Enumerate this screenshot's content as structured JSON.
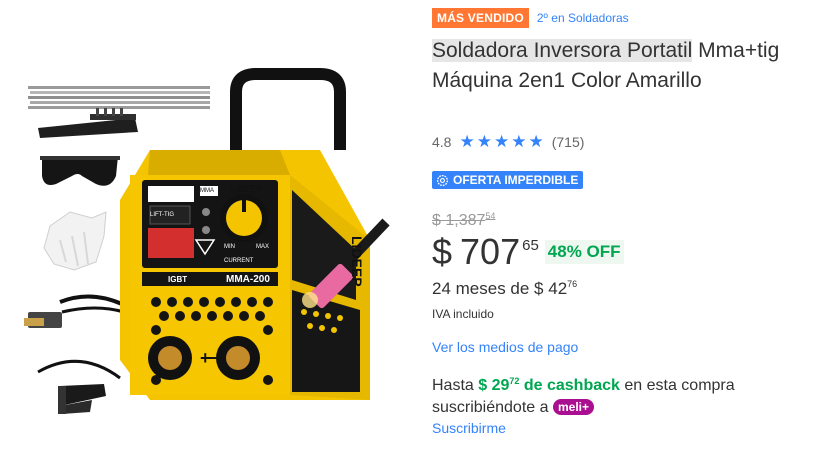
{
  "badges": {
    "best_seller": "MÁS VENDIDO",
    "ranking": "2º en Soldadoras"
  },
  "product": {
    "title_line1": "Soldadora Inversora Portatil",
    "title_rest": "Mma+tig Máquina 2en1 Color Amarillo",
    "image_labels": {
      "brand": "LIDEEP",
      "model": "MMA-200",
      "igbt": "IGBT",
      "mma": "MMA",
      "tig": "LIFT-TIG",
      "current": "CURRENT",
      "min": "MIN",
      "max": "MAX"
    }
  },
  "rating": {
    "value": "4.8",
    "stars": 5,
    "reviews": "(715)"
  },
  "deal": {
    "label": "OFERTA IMPERDIBLE"
  },
  "price": {
    "old_symbol": "$",
    "old_int": "1,387",
    "old_cents": "54",
    "symbol": "$",
    "int": "707",
    "cents": "65",
    "discount": "48% OFF"
  },
  "installments": {
    "prefix": "24 meses de $ 42",
    "cents": "76"
  },
  "tax_note": "IVA incluido",
  "payment_link": "Ver los medios de pago",
  "cashback": {
    "prefix": "Hasta",
    "amount": "$ 29",
    "cents": "72",
    "mid": "de cashback",
    "suffix": "en esta compra suscribiéndote a",
    "badge": "meli+"
  },
  "subscribe_link": "Suscribirme",
  "colors": {
    "accent_blue": "#3483fa",
    "best_seller_orange": "#ff7733",
    "discount_green": "#00a650",
    "meli_purple": "#a90f90",
    "welder_yellow": "#f5c400"
  }
}
